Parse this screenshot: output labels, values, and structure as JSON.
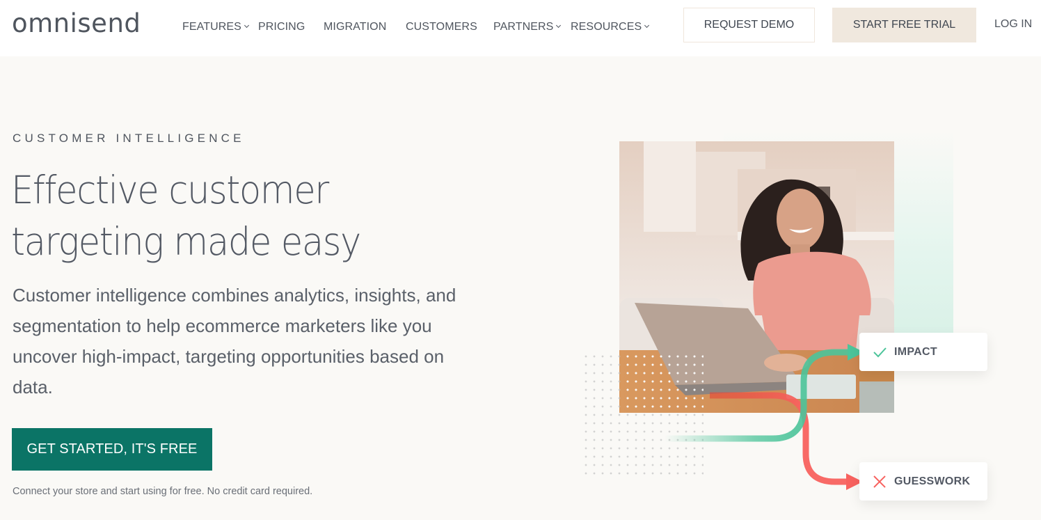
{
  "header": {
    "logo": "omnisend",
    "nav": [
      {
        "label": "FEATURES",
        "dropdown": true
      },
      {
        "label": "PRICING",
        "dropdown": false
      },
      {
        "label": "MIGRATION",
        "dropdown": false
      },
      {
        "label": "CUSTOMERS",
        "dropdown": false
      },
      {
        "label": "PARTNERS",
        "dropdown": true
      },
      {
        "label": "RESOURCES",
        "dropdown": true
      }
    ],
    "request_demo_label": "REQUEST DEMO",
    "start_trial_label": "START FREE TRIAL",
    "login_label": "LOG IN"
  },
  "hero": {
    "eyebrow": "CUSTOMER INTELLIGENCE",
    "headline_line1": "Effective customer",
    "headline_line2": "targeting made easy",
    "description": "Customer intelligence combines analytics, insights, and segmentation to help ecommerce marketers like you uncover high-impact, targeting opportunities based on data.",
    "cta_label": "GET STARTED, IT'S FREE",
    "note": "Connect your store and start using for free. No credit card required."
  },
  "illustration": {
    "photo_alt": "Smiling woman with curly hair using a laptop",
    "impact_label": "IMPACT",
    "impact_icon": "check-icon",
    "guesswork_label": "GUESSWORK",
    "guesswork_icon": "x-icon"
  },
  "colors": {
    "brand_green": "#0b7466",
    "page_bg": "#faf9f6",
    "trial_bg": "#f0e8de",
    "impact_green": "#4cc49a",
    "guess_red": "#f8625f",
    "text": "#50565f"
  }
}
